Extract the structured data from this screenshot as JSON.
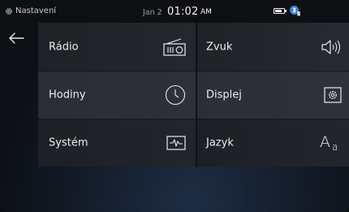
{
  "status": {
    "app_title": "Nastavení",
    "date": "Jan 2",
    "time": "01:02",
    "ampm": "AM",
    "battery_level": 0.75,
    "icons": [
      "gear-icon",
      "battery-icon",
      "bluetooth-phone-icon"
    ]
  },
  "nav": {
    "back_icon": "back-arrow-icon"
  },
  "menu": [
    {
      "label": "Rádio",
      "icon": "radio-icon"
    },
    {
      "label": "Zvuk",
      "icon": "speaker-icon"
    },
    {
      "label": "Hodiny",
      "icon": "clock-icon"
    },
    {
      "label": "Displej",
      "icon": "display-settings-icon"
    },
    {
      "label": "Systém",
      "icon": "system-monitor-icon"
    },
    {
      "label": "Jazyk",
      "icon": "language-icon",
      "glyph": "Aa"
    }
  ],
  "colors": {
    "background": "#0c0f14",
    "tile": "#24282e",
    "text": "#e9ecef",
    "accent": "#3d7fe6"
  }
}
